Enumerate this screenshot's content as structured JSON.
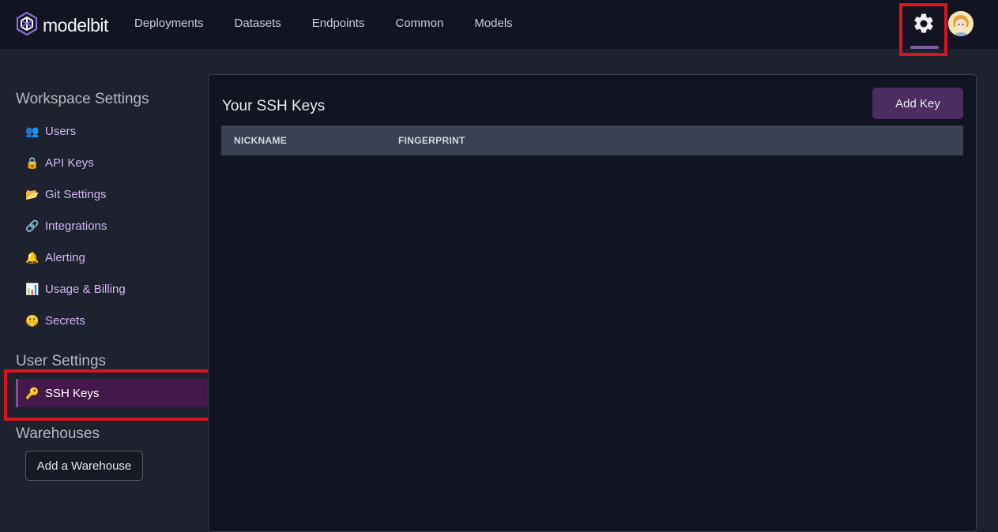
{
  "brand": {
    "name": "modelbit"
  },
  "nav": {
    "items": [
      {
        "label": "Deployments"
      },
      {
        "label": "Datasets"
      },
      {
        "label": "Endpoints"
      },
      {
        "label": "Common"
      },
      {
        "label": "Models"
      }
    ]
  },
  "header": {
    "settings_icon": "gear-icon",
    "avatar_icon": "user-avatar"
  },
  "sidebar": {
    "workspace_title": "Workspace Settings",
    "workspace_items": [
      {
        "icon": "👥",
        "label": "Users"
      },
      {
        "icon": "🔒",
        "label": "API Keys"
      },
      {
        "icon": "📂",
        "label": "Git Settings"
      },
      {
        "icon": "🔗",
        "label": "Integrations"
      },
      {
        "icon": "🔔",
        "label": "Alerting"
      },
      {
        "icon": "📊",
        "label": "Usage & Billing"
      },
      {
        "icon": "🤫",
        "label": "Secrets"
      }
    ],
    "user_title": "User Settings",
    "user_items": [
      {
        "icon": "🔑",
        "label": "SSH Keys",
        "active": true
      }
    ],
    "warehouses_title": "Warehouses",
    "add_warehouse_label": "Add a Warehouse"
  },
  "main": {
    "title": "Your SSH Keys",
    "add_key_label": "Add Key",
    "columns": [
      "NICKNAME",
      "FINGERPRINT"
    ],
    "rows": []
  },
  "colors": {
    "topbar_bg": "#121521",
    "page_bg": "#1e222e",
    "panel_bg": "#111421",
    "accent_purple": "#4b2d5f",
    "active_item_bg": "#431949",
    "highlight_red": "#d7141f",
    "sidebar_link": "#d0b5f0"
  }
}
